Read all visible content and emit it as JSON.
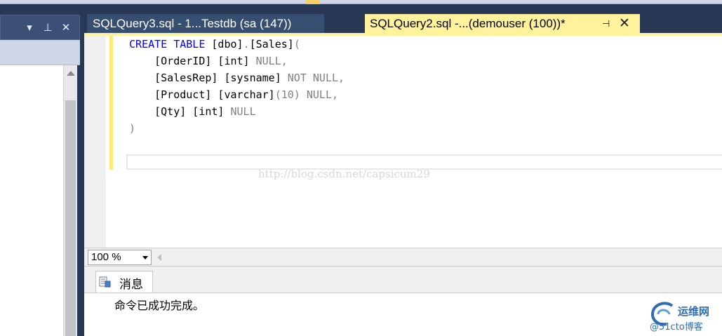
{
  "tabs": [
    {
      "label": "SQLQuery3.sql - 1...Testdb (sa (147))",
      "active": false
    },
    {
      "label": "SQLQuery2.sql -...(demouser (100))*",
      "active": true
    }
  ],
  "tab_icons": {
    "pin": "pin-icon",
    "close": "close-icon"
  },
  "left_panel": {
    "header_icons": [
      "dropdown-icon",
      "pin-icon",
      "close-icon"
    ],
    "dropdown_glyph": "▾",
    "pin_glyph": "⊥",
    "close_glyph": "✕"
  },
  "editor": {
    "code_lines": [
      [
        {
          "t": "CREATE TABLE",
          "c": "kw"
        },
        {
          "t": " [dbo]",
          "c": ""
        },
        {
          "t": ".",
          "c": "gr"
        },
        {
          "t": "[Sales]",
          "c": ""
        },
        {
          "t": "(",
          "c": "gr"
        }
      ],
      [
        {
          "t": "    [OrderID] [int] ",
          "c": ""
        },
        {
          "t": "NULL,",
          "c": "gr"
        }
      ],
      [
        {
          "t": "    [SalesRep] [sysname] ",
          "c": ""
        },
        {
          "t": "NOT NULL,",
          "c": "gr"
        }
      ],
      [
        {
          "t": "    [Product] [varchar]",
          "c": ""
        },
        {
          "t": "(10) NULL,",
          "c": "gr"
        }
      ],
      [
        {
          "t": "    [Qty] [int] ",
          "c": ""
        },
        {
          "t": "NULL",
          "c": "gr"
        }
      ],
      [
        {
          "t": ")",
          "c": "gr"
        }
      ]
    ],
    "watermark": "http://blog.csdn.net/capsicum29"
  },
  "zoom": {
    "value": "100 %"
  },
  "results": {
    "tab_label": "消息",
    "message": "命令已成功完成。"
  },
  "logo": {
    "line1": "运维网",
    "line2": "@51cto博客"
  },
  "colors": {
    "keyword": "#0000ff",
    "gray_text": "#808080",
    "active_tab": "#fff29d",
    "inactive_tab": "#364e6f",
    "frame": "#293955"
  }
}
